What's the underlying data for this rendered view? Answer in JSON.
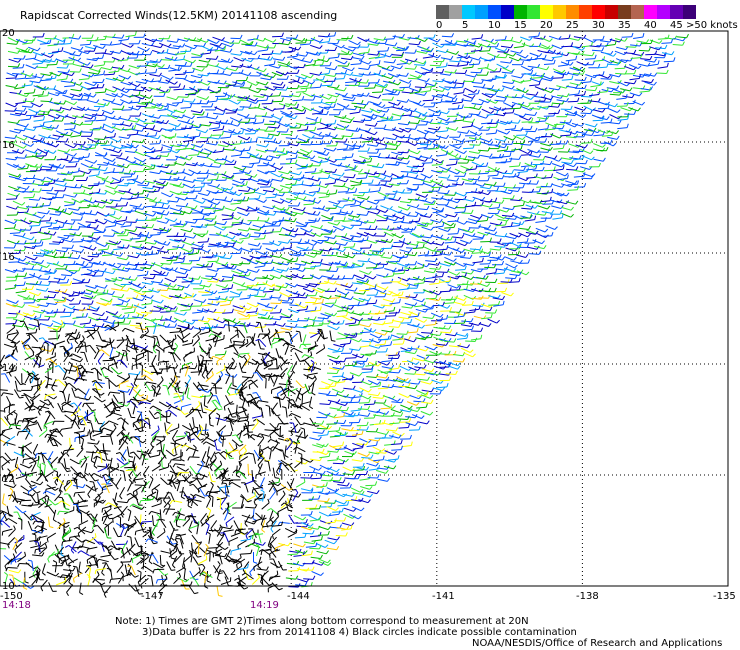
{
  "title": "Rapidscat Corrected Winds(12.5KM) 20141108 ascending",
  "colorbar": {
    "colors": [
      "#606060",
      "#a0a0a0",
      "#00c8ff",
      "#00a0ff",
      "#0050ff",
      "#0000c8",
      "#00b400",
      "#32e632",
      "#ffff00",
      "#ffc800",
      "#ff8c00",
      "#ff4000",
      "#ff0000",
      "#c80000",
      "#783c1e",
      "#b46450",
      "#ff00ff",
      "#b400ff",
      "#6400b4",
      "#3c0078"
    ],
    "labels": [
      "0",
      "5",
      "10",
      "15",
      "20",
      "25",
      "30",
      "35",
      "40",
      "45"
    ],
    "max_label": ">50 knots"
  },
  "axes": {
    "lat_labels": [
      "20",
      "16",
      "16",
      "14",
      "12",
      "10"
    ],
    "lon_labels": [
      "-150",
      "-147",
      "-144",
      "-141",
      "-138",
      "-135"
    ],
    "lon_range": [
      -150,
      -135
    ],
    "lat_range": [
      10,
      20
    ]
  },
  "time_labels": [
    "14:18",
    "14:19"
  ],
  "notes": {
    "line1": "Note: 1) Times are GMT 2)Times along bottom correspond to measurement at 20N",
    "line2": "3)Data buffer is 22 hrs from 20141108 4) Black circles indicate possible contamination",
    "line3": "NOAA/NESDIS/Office of Research and Applications"
  }
}
